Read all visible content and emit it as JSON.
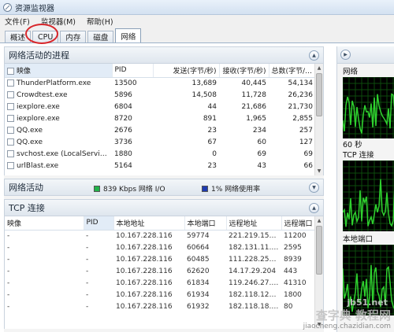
{
  "window": {
    "title": "资源监视器"
  },
  "menu": [
    "文件(F)",
    "监视器(M)",
    "帮助(H)"
  ],
  "tabs": [
    {
      "label": "概述",
      "active": false
    },
    {
      "label": "CPU",
      "active": false,
      "highlighted": true
    },
    {
      "label": "内存",
      "active": false
    },
    {
      "label": "磁盘",
      "active": false
    },
    {
      "label": "网络",
      "active": true
    }
  ],
  "processes": {
    "title": "网络活动的进程",
    "columns": [
      "映像",
      "PID",
      "发送(字节/秒)",
      "接收(字节/秒)",
      "总数(字节/秒)"
    ],
    "rows": [
      [
        "ThunderPlatform.exe",
        "13500",
        "13,689",
        "40,445",
        "54,134"
      ],
      [
        "Crowdtest.exe",
        "5896",
        "14,508",
        "11,728",
        "26,236"
      ],
      [
        "iexplore.exe",
        "6804",
        "44",
        "21,686",
        "21,730"
      ],
      [
        "iexplore.exe",
        "8720",
        "891",
        "1,965",
        "2,855"
      ],
      [
        "QQ.exe",
        "2676",
        "23",
        "234",
        "257"
      ],
      [
        "QQ.exe",
        "3736",
        "67",
        "60",
        "127"
      ],
      [
        "svchost.exe (LocalServiceA...",
        "1880",
        "0",
        "69",
        "69"
      ],
      [
        "urlBlast.exe",
        "5164",
        "23",
        "43",
        "66"
      ]
    ]
  },
  "network_activity": {
    "title": "网络活动",
    "io_label": "839 Kbps 网络 I/O",
    "usage_label": "1% 网络使用率",
    "io_color": "#22b34a",
    "usage_color": "#1f3bb0"
  },
  "tcp": {
    "title": "TCP 连接",
    "columns": [
      "映像",
      "PID",
      "本地地址",
      "本地端口",
      "远程地址",
      "远程端口"
    ],
    "rows": [
      [
        "-",
        "-",
        "10.167.228.116",
        "59774",
        "221.219.152.2...",
        "11200"
      ],
      [
        "-",
        "-",
        "10.167.228.116",
        "60664",
        "182.131.11.55",
        "2595"
      ],
      [
        "-",
        "-",
        "10.167.228.116",
        "60485",
        "111.228.251.19",
        "8939"
      ],
      [
        "-",
        "-",
        "10.167.228.116",
        "62620",
        "14.17.29.204",
        "443"
      ],
      [
        "-",
        "-",
        "10.167.228.116",
        "61834",
        "119.246.27.67",
        "41310"
      ],
      [
        "-",
        "-",
        "10.167.228.116",
        "61934",
        "182.118.125.29",
        "1800"
      ],
      [
        "-",
        "-",
        "10.167.228.116",
        "61932",
        "182.118.18.82",
        "80"
      ]
    ]
  },
  "right_panel": {
    "network_label": "网络",
    "time_label": "60 秒",
    "tcp_label": "TCP 连接",
    "local_label": "本地端口",
    "graph_color": "#2fd12f"
  },
  "watermark": {
    "site": "jb51.net",
    "main": "查字典 教程网",
    "sub": "jiaocheng.chazidian.com"
  }
}
